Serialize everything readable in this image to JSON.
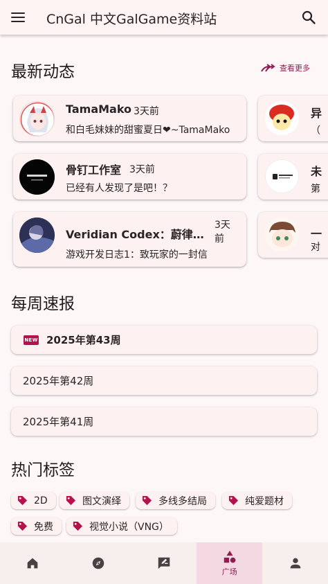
{
  "app": {
    "title": "CnGal 中文GalGame资料站"
  },
  "colors": {
    "accent": "#8e1e52",
    "tag": "#b5114c",
    "surface": "#fdf2f1"
  },
  "news": {
    "title": "最新动态",
    "see_more": "查看更多",
    "cards": [
      {
        "name": "TamaMako",
        "time": "3天前",
        "message": "和白毛妹妹的甜蜜夏日❤~TamaMako"
      },
      {
        "name": "骨钉工作室",
        "time": "3天前",
        "message": "已经有人发现了是吧！？"
      },
      {
        "name": "Veridian Codex：蔚律法典",
        "time": "3天前",
        "message": "游戏开发日志1：致玩家的一封信"
      }
    ],
    "peek_cards": [
      {
        "name": "异",
        "sub": "（"
      },
      {
        "name": "未",
        "sub": "第"
      },
      {
        "name": "一",
        "sub": "对"
      }
    ]
  },
  "weekly": {
    "title": "每周速报",
    "badge": "NEW",
    "items": [
      "2025年第43周",
      "2025年第42周",
      "2025年第41周"
    ]
  },
  "tags": {
    "title": "热门标签",
    "items": [
      "2D",
      "图文演绎",
      "多线多结局",
      "纯爱题材",
      "免费",
      "视觉小说（VNG）"
    ]
  },
  "bottom_nav": {
    "items": [
      {
        "icon": "home-icon",
        "label": ""
      },
      {
        "icon": "compass-icon",
        "label": ""
      },
      {
        "icon": "edit-note-icon",
        "label": ""
      },
      {
        "icon": "shapes-icon",
        "label": "广场"
      },
      {
        "icon": "person-icon",
        "label": ""
      }
    ]
  }
}
